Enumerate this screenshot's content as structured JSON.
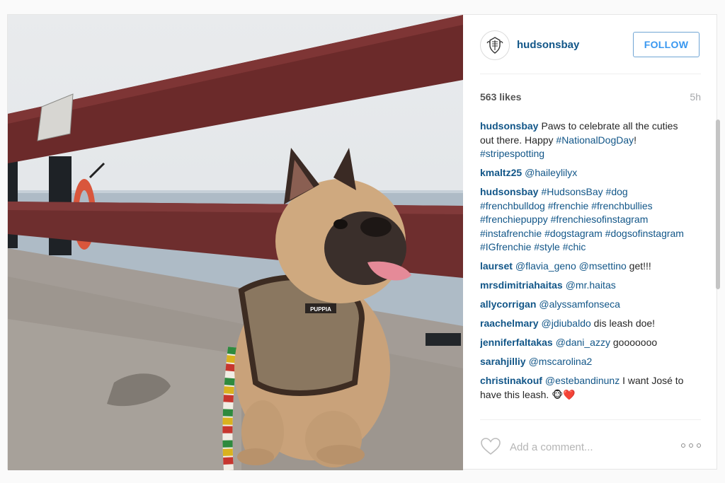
{
  "post": {
    "username": "hudsonsbay",
    "follow_label": "FOLLOW",
    "likes": "563 likes",
    "time": "5h",
    "photo_label": "PUPPIA"
  },
  "comments": [
    {
      "user": "hudsonsbay",
      "parts": [
        {
          "t": "Paws to celebrate all the cuties out there. Happy "
        },
        {
          "t": "#NationalDogDay",
          "tag": true
        },
        {
          "t": "! "
        },
        {
          "t": "#stripespotting",
          "tag": true
        }
      ]
    },
    {
      "user": "kmaltz25",
      "parts": [
        {
          "t": "@haileylilyx",
          "tag": true
        }
      ]
    },
    {
      "user": "hudsonsbay",
      "parts": [
        {
          "t": "#HudsonsBay",
          "tag": true
        },
        {
          "t": " "
        },
        {
          "t": "#dog",
          "tag": true
        },
        {
          "t": " "
        },
        {
          "t": "#frenchbulldog",
          "tag": true
        },
        {
          "t": " "
        },
        {
          "t": "#frenchie",
          "tag": true
        },
        {
          "t": " "
        },
        {
          "t": "#frenchbullies",
          "tag": true
        },
        {
          "t": " "
        },
        {
          "t": "#frenchiepuppy",
          "tag": true
        },
        {
          "t": " "
        },
        {
          "t": "#frenchiesofinstagram",
          "tag": true
        },
        {
          "t": " "
        },
        {
          "t": "#instafrenchie",
          "tag": true
        },
        {
          "t": " "
        },
        {
          "t": "#dogstagram",
          "tag": true
        },
        {
          "t": " "
        },
        {
          "t": "#dogsofinstagram",
          "tag": true
        },
        {
          "t": " "
        },
        {
          "t": "#IGfrenchie",
          "tag": true
        },
        {
          "t": " "
        },
        {
          "t": "#style",
          "tag": true
        },
        {
          "t": " "
        },
        {
          "t": "#chic",
          "tag": true
        }
      ]
    },
    {
      "user": "laurset",
      "parts": [
        {
          "t": "@flavia_geno",
          "tag": true
        },
        {
          "t": " "
        },
        {
          "t": "@msettino",
          "tag": true
        },
        {
          "t": " get!!!"
        }
      ]
    },
    {
      "user": "mrsdimitriahaitas",
      "parts": [
        {
          "t": "@mr.haitas",
          "tag": true
        }
      ]
    },
    {
      "user": "allycorrigan",
      "parts": [
        {
          "t": "@alyssamfonseca",
          "tag": true
        }
      ]
    },
    {
      "user": "raachelmary",
      "parts": [
        {
          "t": "@jdiubaldo",
          "tag": true
        },
        {
          "t": " dis leash doe!"
        }
      ]
    },
    {
      "user": "jenniferfaltakas",
      "parts": [
        {
          "t": "@dani_azzy",
          "tag": true
        },
        {
          "t": " gooooooo"
        }
      ]
    },
    {
      "user": "sarahjilliy",
      "parts": [
        {
          "t": "@mscarolina2",
          "tag": true
        }
      ]
    },
    {
      "user": "christinakouf",
      "parts": [
        {
          "t": "@estebandinunz",
          "tag": true
        },
        {
          "t": " I want José to have this leash. 🐵❤️"
        }
      ]
    }
  ],
  "footer": {
    "add_comment_placeholder": "Add a comment..."
  },
  "icons": {
    "avatar": "hbc-coat-of-arms-icon",
    "like": "heart-icon",
    "more": "more-options-icon"
  },
  "colors": {
    "username": "#125688",
    "follow": "#3897f0",
    "text": "#262626",
    "muted": "#a5a7aa"
  }
}
